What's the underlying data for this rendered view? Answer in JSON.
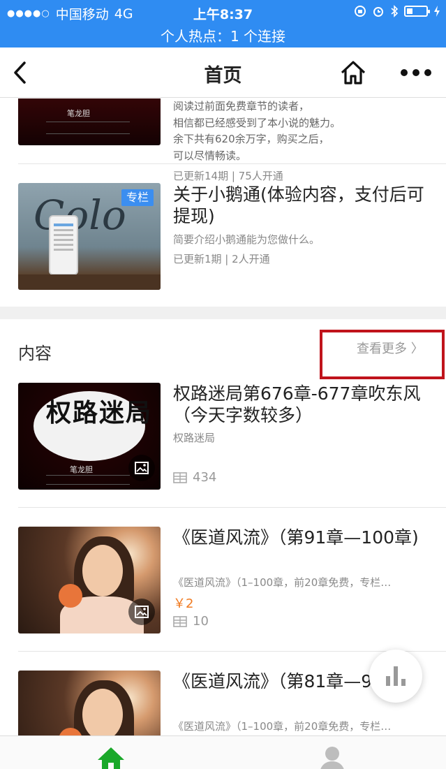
{
  "status_bar": {
    "signal_dots": "●●●●○",
    "carrier": "中国移动",
    "network": "4G",
    "time": "上午8:37",
    "hotspot": "个人热点：1 个连接"
  },
  "nav": {
    "title": "首页"
  },
  "colors": {
    "status_bar": "#2f8cf2",
    "accent_blue": "#3b8ef0",
    "price_orange": "#f07a20",
    "highlight_red": "#c0141c",
    "tab_active_green": "#1aa82a"
  },
  "intro_item": {
    "description_lines": [
      "阅读过前面免费章节的读者，",
      "相信都已经感受到了本小说的魅力。",
      "余下共有620余万字，购买之后，",
      "可以尽情畅读。"
    ],
    "updated": "已更新14期 | 75人开通"
  },
  "column_item": {
    "badge": "专栏",
    "title": "关于小鹅通(体验内容，支付后可提现)",
    "subtitle": "简要介绍小鹅通能为您做什么。",
    "meta": "已更新1期 | 2人开通"
  },
  "content_section": {
    "title": "内容",
    "see_more": "查看更多 〉",
    "items": [
      {
        "title": "权路迷局第676章-677章吹东风（今天字数较多）",
        "subtitle": "权路迷局",
        "price": "",
        "count": "434",
        "cover_text": "权路迷局"
      },
      {
        "title": "《医道风流》（第91章—100章)",
        "subtitle": "《医道风流》（1–100章，前20章免费，专栏…",
        "price": "￥2",
        "count": "10"
      },
      {
        "title": "《医道风流》（第81章—90章)",
        "subtitle": "《医道风流》（1–100章，前20章免费，专栏…",
        "price": "",
        "count": ""
      }
    ]
  },
  "icons": {
    "back": "chevron-left-icon",
    "home": "home-icon",
    "more": "more-dots-icon",
    "image": "image-icon",
    "count": "grid-icon",
    "stats": "bar-chart-icon",
    "tab_home": "home-icon",
    "tab_user": "user-icon"
  }
}
